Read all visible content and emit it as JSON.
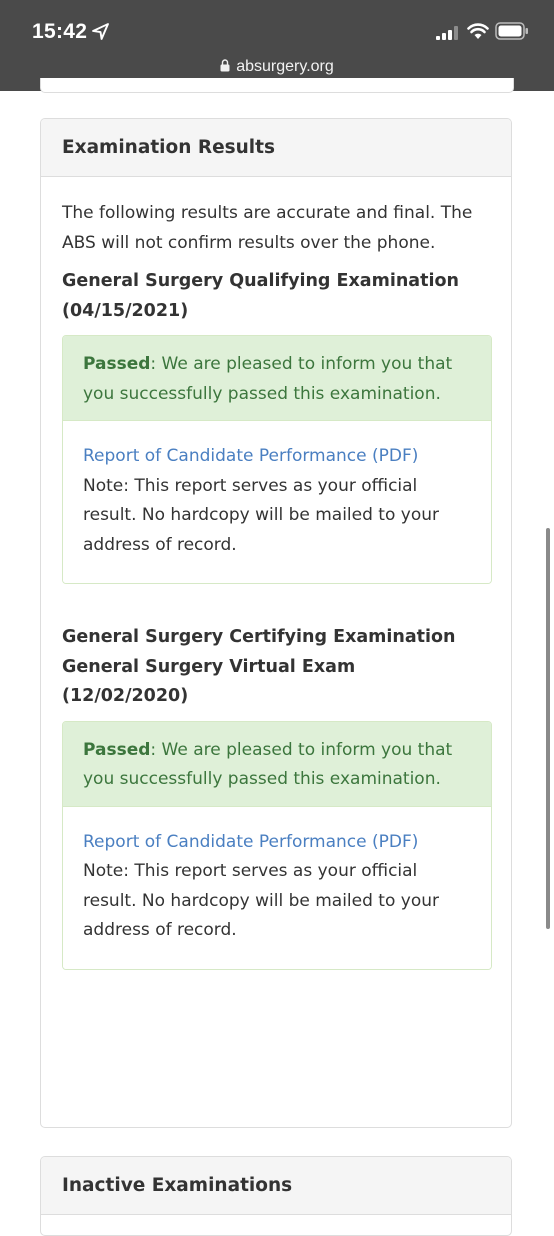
{
  "status_bar": {
    "time": "15:42",
    "location_icon": "location-arrow-icon",
    "signal_icon": "cellular-signal-icon",
    "wifi_icon": "wifi-icon",
    "battery_icon": "battery-icon"
  },
  "browser": {
    "url": "absurgery.org",
    "lock_icon": "lock-icon"
  },
  "panel": {
    "heading": "Examination Results",
    "intro": "The following results are accurate and final. The ABS will not confirm results over the phone.",
    "exams": [
      {
        "title_lines": [
          "General Surgery Qualifying Examination",
          "(04/15/2021)"
        ],
        "status": "Passed",
        "message": ": We are pleased to inform you that you successfully passed this examination.",
        "report_link": "Report of Candidate Performance (PDF)",
        "note": "Note: This report serves as your official result. No hardcopy will be mailed to your address of record."
      },
      {
        "title_lines": [
          "General Surgery Certifying Examination",
          "General Surgery Virtual Exam",
          "(12/02/2020)"
        ],
        "status": "Passed",
        "message": ": We are pleased to inform you that you successfully passed this examination.",
        "report_link": "Report of Candidate Performance (PDF)",
        "note": "Note: This report serves as your official result. No hardcopy will be mailed to your address of record."
      }
    ]
  },
  "inactive_panel": {
    "heading": "Inactive Examinations"
  },
  "colors": {
    "status_bar_bg": "#4a4a4a",
    "success_bg": "#dff0d8",
    "success_text": "#3c763d",
    "link": "#4a7fc1"
  }
}
